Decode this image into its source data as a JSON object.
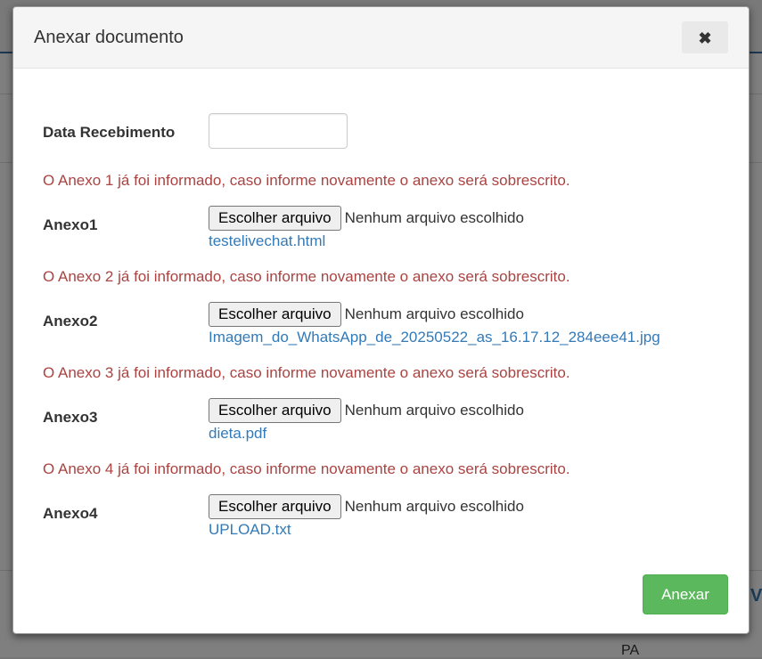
{
  "modal": {
    "title": "Anexar documento",
    "close_label": "✖",
    "date_label": "Data Recebimento",
    "date_value": "",
    "attachments": [
      {
        "warning": "O Anexo 1 já foi informado, caso informe novamente o anexo será sobrescrito.",
        "label": "Anexo1",
        "button": "Escolher arquivo",
        "status": "Nenhum arquivo escolhido",
        "file": "testelivechat.html"
      },
      {
        "warning": "O Anexo 2 já foi informado, caso informe novamente o anexo será sobrescrito.",
        "label": "Anexo2",
        "button": "Escolher arquivo",
        "status": "Nenhum arquivo escolhido",
        "file": "Imagem_do_WhatsApp_de_20250522_as_16.17.12_284eee41.jpg"
      },
      {
        "warning": "O Anexo 3 já foi informado, caso informe novamente o anexo será sobrescrito.",
        "label": "Anexo3",
        "button": "Escolher arquivo",
        "status": "Nenhum arquivo escolhido",
        "file": "dieta.pdf"
      },
      {
        "warning": "O Anexo 4 já foi informado, caso informe novamente o anexo será sobrescrito.",
        "label": "Anexo4",
        "button": "Escolher arquivo",
        "status": "Nenhum arquivo escolhido",
        "file": "UPLOAD.txt"
      }
    ],
    "submit_label": "Anexar"
  },
  "background": {
    "fragments": [
      "PA",
      "V"
    ]
  },
  "colors": {
    "warning": "#a94442",
    "link": "#337ab7",
    "success": "#5cb85c"
  }
}
